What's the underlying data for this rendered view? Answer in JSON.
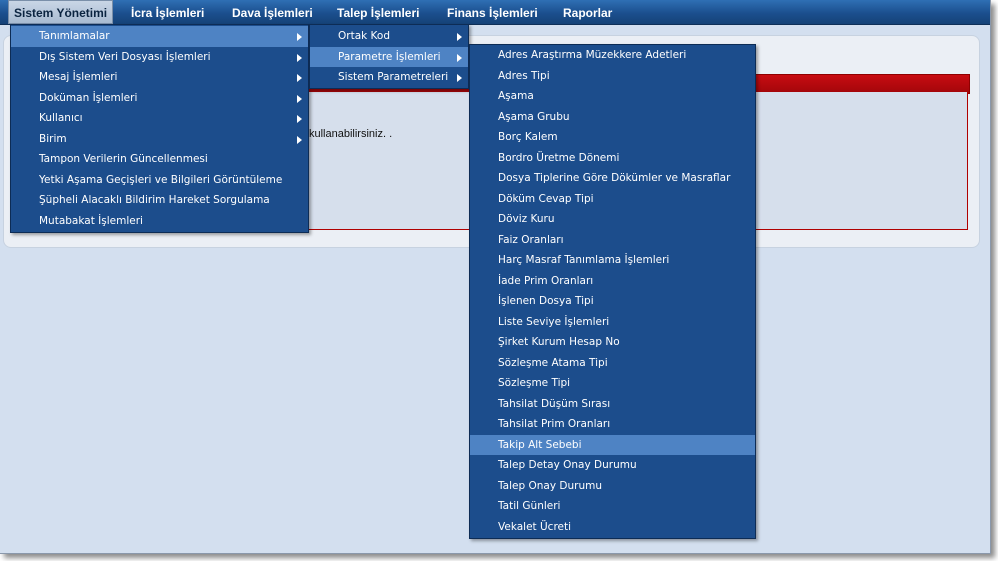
{
  "topnav": {
    "items": [
      {
        "label": "Sistem Yönetimi"
      },
      {
        "label": "İcra İşlemleri"
      },
      {
        "label": "Dava İşlemleri"
      },
      {
        "label": "Talep İşlemleri"
      },
      {
        "label": "Finans İşlemleri"
      },
      {
        "label": "Raporlar"
      }
    ]
  },
  "content": {
    "text": "kullanabilirsiniz. ."
  },
  "menu1": {
    "items": [
      {
        "label": "Tanımlamalar"
      },
      {
        "label": "Dış Sistem Veri Dosyası İşlemleri"
      },
      {
        "label": "Mesaj İşlemleri"
      },
      {
        "label": "Doküman İşlemleri"
      },
      {
        "label": "Kullanıcı"
      },
      {
        "label": "Birim"
      },
      {
        "label": "Tampon Verilerin Güncellenmesi"
      },
      {
        "label": "Yetki Aşama Geçişleri ve Bilgileri Görüntüleme"
      },
      {
        "label": "Şüpheli Alacaklı Bildirim Hareket Sorgulama"
      },
      {
        "label": "Mutabakat İşlemleri"
      }
    ]
  },
  "menu2": {
    "items": [
      {
        "label": "Ortak Kod"
      },
      {
        "label": "Parametre İşlemleri"
      },
      {
        "label": "Sistem Parametreleri"
      }
    ]
  },
  "menu3": {
    "items": [
      {
        "label": "Adres Araştırma Müzekkere Adetleri"
      },
      {
        "label": "Adres Tipi"
      },
      {
        "label": "Aşama"
      },
      {
        "label": "Aşama Grubu"
      },
      {
        "label": "Borç Kalem"
      },
      {
        "label": "Bordro Üretme Dönemi"
      },
      {
        "label": "Dosya Tiplerine Göre Dökümler ve Masraflar"
      },
      {
        "label": "Döküm Cevap Tipi"
      },
      {
        "label": "Döviz Kuru"
      },
      {
        "label": "Faiz Oranları"
      },
      {
        "label": "Harç Masraf Tanımlama İşlemleri"
      },
      {
        "label": "İade Prim Oranları"
      },
      {
        "label": "İşlenen Dosya Tipi"
      },
      {
        "label": "Liste Seviye İşlemleri"
      },
      {
        "label": "Şirket Kurum Hesap No"
      },
      {
        "label": "Sözleşme Atama Tipi"
      },
      {
        "label": "Sözleşme Tipi"
      },
      {
        "label": "Tahsilat Düşüm Sırası"
      },
      {
        "label": "Tahsilat Prim Oranları"
      },
      {
        "label": "Takip Alt Sebebi"
      },
      {
        "label": "Talep Detay Onay Durumu"
      },
      {
        "label": "Talep Onay Durumu"
      },
      {
        "label": "Tatil Günleri"
      },
      {
        "label": "Vekalet Ücreti"
      }
    ]
  }
}
